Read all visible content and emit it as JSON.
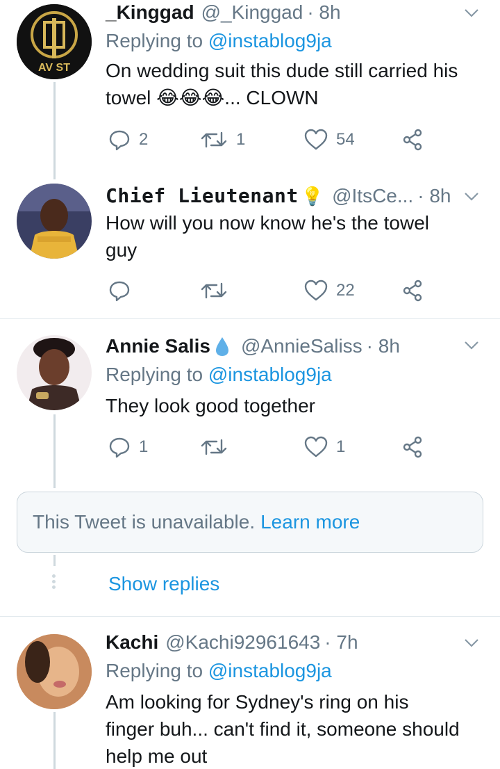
{
  "tweets": [
    {
      "name": "_Kinggad",
      "handle": "@_Kinggad",
      "time": "· 8h",
      "replying_prefix": "Replying to ",
      "replying_to": "@instablog9ja",
      "text_line1": "On wedding suit this dude still carried his",
      "text_line2": "towel 😂😂😂... CLOWN",
      "avatar_text": "AV ST",
      "replies": "2",
      "retweets": "1",
      "likes": "54"
    },
    {
      "name": "Chief Lieutenant",
      "badge": "💡",
      "handle": "@ItsCe...",
      "time": "· 8h",
      "text_line1": "How will you now know he's the towel",
      "text_line2": "guy",
      "likes": "22"
    },
    {
      "name": "Annie Salis",
      "handle": "@AnnieSaliss",
      "time": "· 8h",
      "replying_prefix": "Replying to ",
      "replying_to": "@instablog9ja",
      "text_line1": "They look good together",
      "replies": "1",
      "likes": "1"
    },
    {
      "name": "Kachi",
      "handle": "@Kachi92961643",
      "time": "· 7h",
      "replying_prefix": "Replying to ",
      "replying_to": "@instablog9ja",
      "text_line1": "Am looking for Sydney's ring on his",
      "text_line2": "finger buh... can't find it, someone should",
      "text_line3": "help me out"
    }
  ],
  "unavailable": {
    "text": "This Tweet is unavailable.",
    "link": "Learn more"
  },
  "show_replies": "Show replies",
  "colors": {
    "text": "#14171a",
    "muted": "#657786",
    "link": "#1b95e0",
    "line": "#cfd9de",
    "divider": "#e1e8ed"
  },
  "icons": [
    "reply-icon",
    "retweet-icon",
    "like-icon",
    "share-icon",
    "chevron-down-icon",
    "water-drop-icon",
    "bulb-icon"
  ]
}
